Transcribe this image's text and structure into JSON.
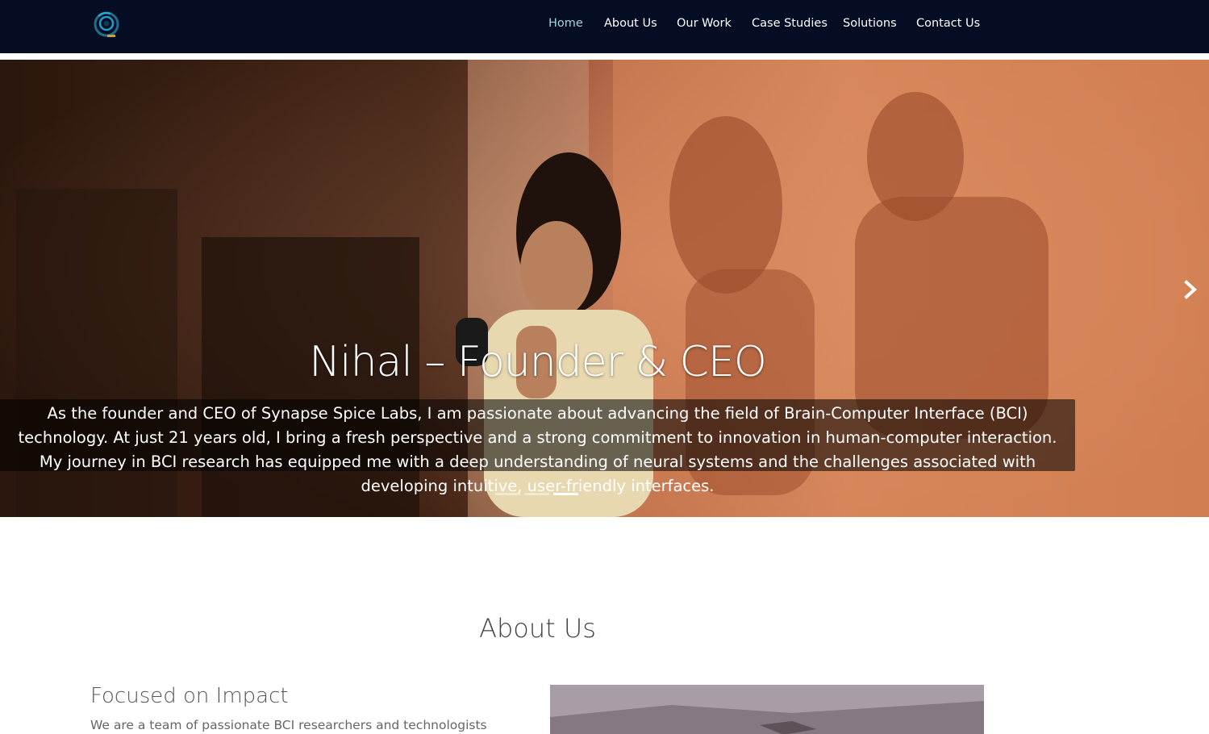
{
  "nav": {
    "logo_icon": "synapse-spice-logo",
    "links": [
      {
        "label": "Home",
        "active": true
      },
      {
        "label": "About Us",
        "active": false
      },
      {
        "label": "Our Work",
        "active": false
      },
      {
        "label": "Case Studies",
        "active": false
      },
      {
        "label": "Solutions",
        "active": false
      },
      {
        "label": "Contact Us",
        "active": false
      }
    ]
  },
  "hero": {
    "title": "Nihal – Founder & CEO",
    "caption": "As the founder and CEO of Synapse Spice Labs, I am passionate about advancing the field of Brain-Computer Interface (BCI) technology. At just 21 years old, I bring a fresh perspective and a strong commitment to innovation in human-computer interaction. My journey in BCI research has equipped me with a deep understanding of neural systems and the challenges associated with developing intuitive, user-friendly interfaces.",
    "slide_count": 3,
    "active_slide": 3,
    "next_icon": "chevron-right-icon"
  },
  "about": {
    "heading": "About Us",
    "subheading": "Focused on Impact",
    "text": "We are a team of passionate BCI researchers and technologists"
  },
  "colors": {
    "nav_bg": "#040d24",
    "nav_active": "#9fd6df",
    "nav_text": "#ffffff"
  }
}
